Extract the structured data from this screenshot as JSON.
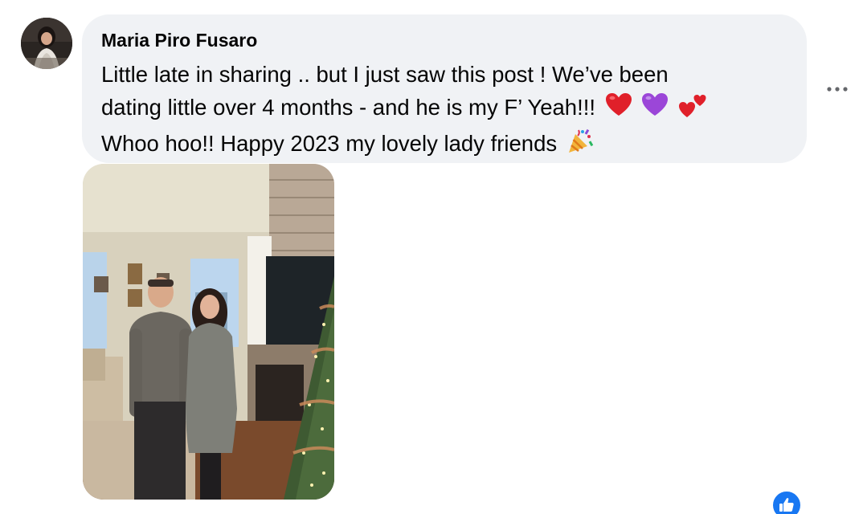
{
  "comment": {
    "author": "Maria Piro Fusaro",
    "lines": [
      "Little late in sharing .. but I just saw this post ! We’ve been",
      "dating little over 4 months - and he is my F’ Yeah!!!",
      "Whoo hoo!! Happy 2023 my lovely lady friends"
    ],
    "emojis_line2": [
      "red-heart-icon",
      "purple-heart-icon",
      "two-hearts-icon"
    ],
    "emoji_line3": "party-popper-icon",
    "reaction": "like-icon"
  },
  "colors": {
    "bubble_bg": "#f0f2f5",
    "text": "#050505",
    "like_blue": "#1877f2"
  }
}
